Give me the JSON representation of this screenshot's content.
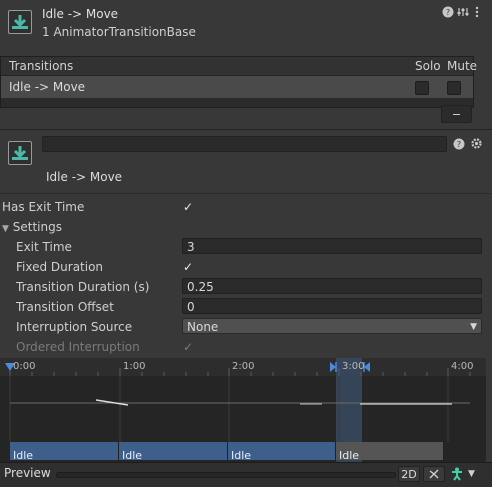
{
  "header": {
    "title": "Idle -> Move",
    "subtitle": "1 AnimatorTransitionBase"
  },
  "transitions_panel": {
    "heading": "Transitions",
    "solo_label": "Solo",
    "mute_label": "Mute",
    "rows": [
      {
        "label": "Idle -> Move",
        "solo": false,
        "mute": false
      }
    ],
    "remove_label": "−"
  },
  "transition": {
    "name": "Idle -> Move",
    "has_exit_time_label": "Has Exit Time",
    "has_exit_time": true,
    "settings_label": "Settings",
    "fields": {
      "exit_time_label": "Exit Time",
      "exit_time": "3",
      "fixed_duration_label": "Fixed Duration",
      "fixed_duration": true,
      "transition_duration_label": "Transition Duration (s)",
      "transition_duration": "0.25",
      "transition_offset_label": "Transition Offset",
      "transition_offset": "0",
      "interruption_source_label": "Interruption Source",
      "interruption_source": "None",
      "ordered_interruption_label": "Ordered Interruption",
      "ordered_interruption": true
    }
  },
  "timeline": {
    "ticks": [
      "0:00",
      "1:00",
      "2:00",
      "3:00",
      "4:00"
    ],
    "bars": [
      "Idle",
      "Idle",
      "Idle",
      "Idle"
    ],
    "accent_color": "#3e5f8c",
    "marker_color": "#4a8ae0"
  },
  "preview": {
    "label": "Preview",
    "mode_2d": "2D"
  },
  "icons": {
    "header": "transition-arrow-icon",
    "help": "help-icon",
    "sliders": "sliders-icon",
    "kebab": "kebab-menu-icon",
    "gear": "gear-icon"
  }
}
